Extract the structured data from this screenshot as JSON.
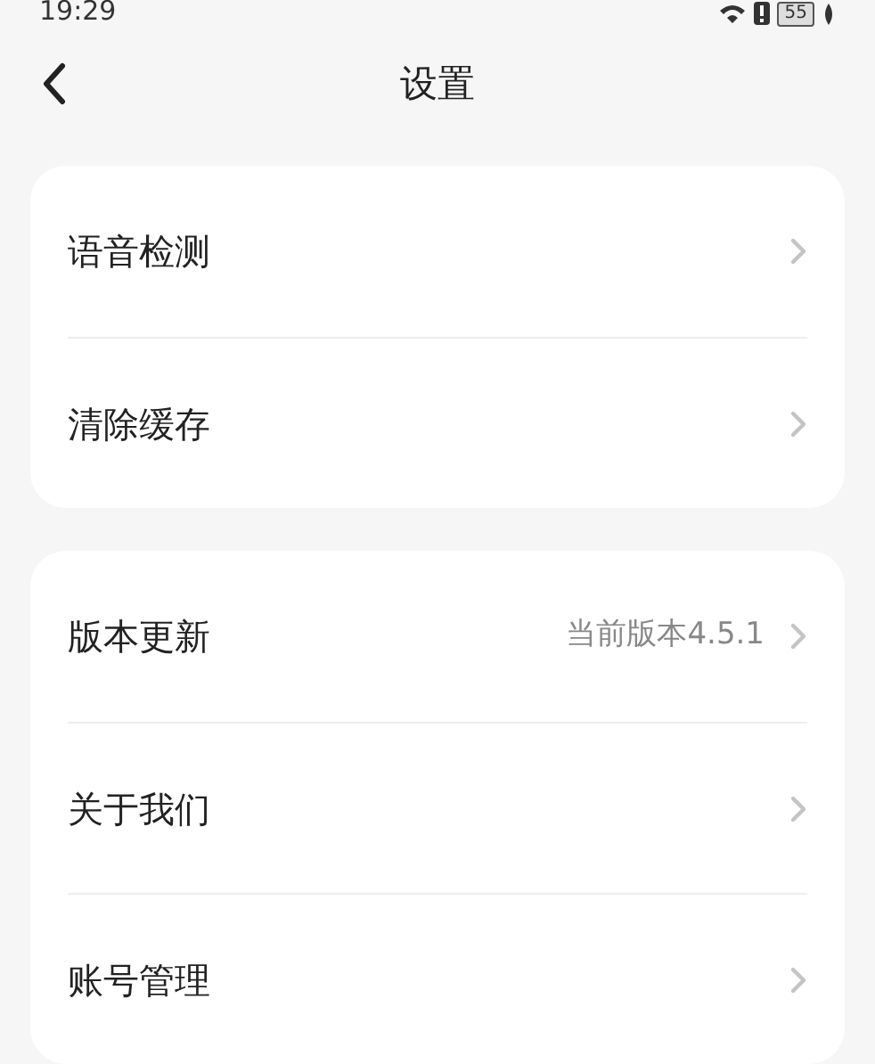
{
  "status_bar": {
    "time": "19:29",
    "battery": "55"
  },
  "header": {
    "title": "设置"
  },
  "groups": [
    {
      "items": [
        {
          "label": "语音检测"
        },
        {
          "label": "清除缓存"
        }
      ]
    },
    {
      "items": [
        {
          "label": "版本更新",
          "value": "当前版本4.5.1"
        },
        {
          "label": "关于我们"
        },
        {
          "label": "账号管理"
        }
      ]
    }
  ]
}
